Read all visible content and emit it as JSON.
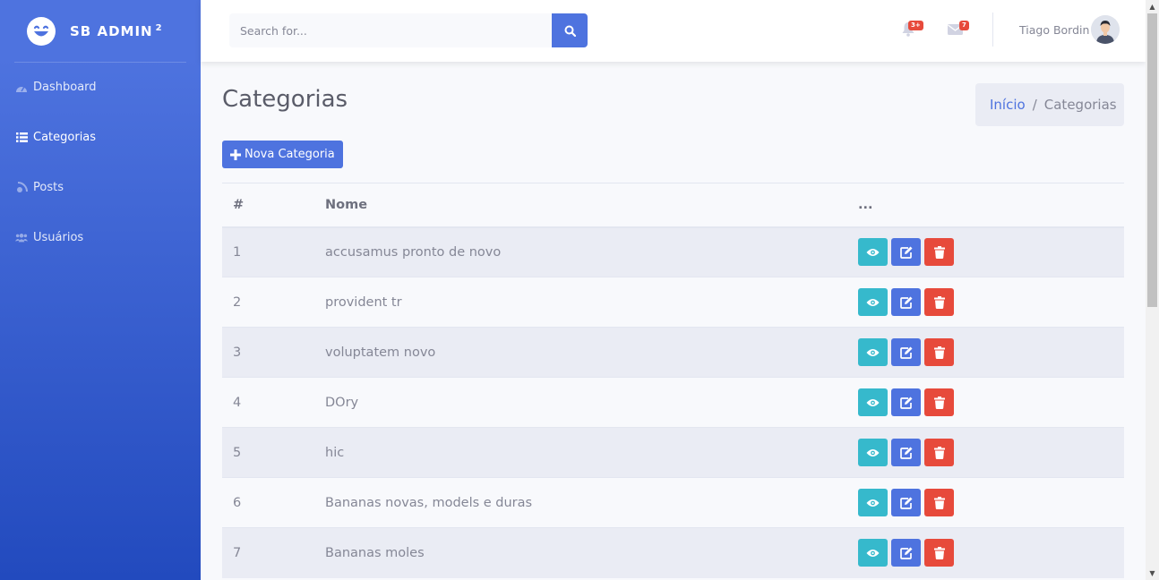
{
  "brand": {
    "name": "SB ADMIN",
    "sup": "2"
  },
  "sidebar": {
    "items": [
      {
        "label": "Dashboard",
        "icon": "tachometer-icon"
      },
      {
        "label": "Categorias",
        "icon": "list-icon",
        "active": true
      },
      {
        "label": "Posts",
        "icon": "blog-icon"
      },
      {
        "label": "Usuários",
        "icon": "users-icon"
      }
    ]
  },
  "topbar": {
    "search": {
      "placeholder": "Search for..."
    },
    "alerts_badge": "3+",
    "messages_badge": "7",
    "user_name": "Tiago Bordin"
  },
  "page": {
    "title": "Categorias",
    "breadcrumb": {
      "home": "Início",
      "separator": "/",
      "current": "Categorias"
    },
    "new_button_label": "Nova Categoria"
  },
  "table": {
    "headers": [
      "#",
      "Nome",
      "..."
    ],
    "rows": [
      {
        "id": "1",
        "name": "accusamus pronto de novo"
      },
      {
        "id": "2",
        "name": "provident tr"
      },
      {
        "id": "3",
        "name": "voluptatem novo"
      },
      {
        "id": "4",
        "name": "DOry"
      },
      {
        "id": "5",
        "name": "hic"
      },
      {
        "id": "6",
        "name": "Bananas novas, models e duras"
      },
      {
        "id": "7",
        "name": "Bananas moles"
      }
    ]
  },
  "colors": {
    "primary": "#4e73df",
    "info": "#36b9cc",
    "danger": "#e74a3b",
    "stripe": "#eaecf4"
  }
}
